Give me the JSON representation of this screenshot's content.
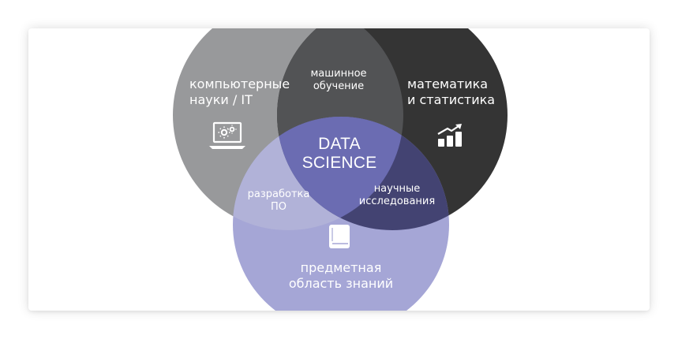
{
  "diagram": {
    "circles": {
      "computer_science": {
        "line1": "компьютерные",
        "line2": "науки / IT",
        "color": "#98999b",
        "icon": "laptop-gears-icon"
      },
      "math_statistics": {
        "line1": "математика",
        "line2": "и статистика",
        "color": "#343434",
        "icon": "bar-chart-growth-icon"
      },
      "domain_knowledge": {
        "line1": "предметная",
        "line2": "область знаний",
        "color": "#a5a6d6",
        "icon": "book-icon"
      }
    },
    "intersections": {
      "machine_learning": {
        "line1": "машинное",
        "line2": "обучение",
        "color": "#525355"
      },
      "software_development": {
        "line1": "разработка",
        "line2": "ПО",
        "color": "#b1b2d8"
      },
      "scientific_research": {
        "line1": "научные",
        "line2": "исследования",
        "color": "#434372"
      },
      "data_science": {
        "line1": "DATA",
        "line2": "SCIENCE",
        "color": "#6b6cb2"
      }
    }
  }
}
